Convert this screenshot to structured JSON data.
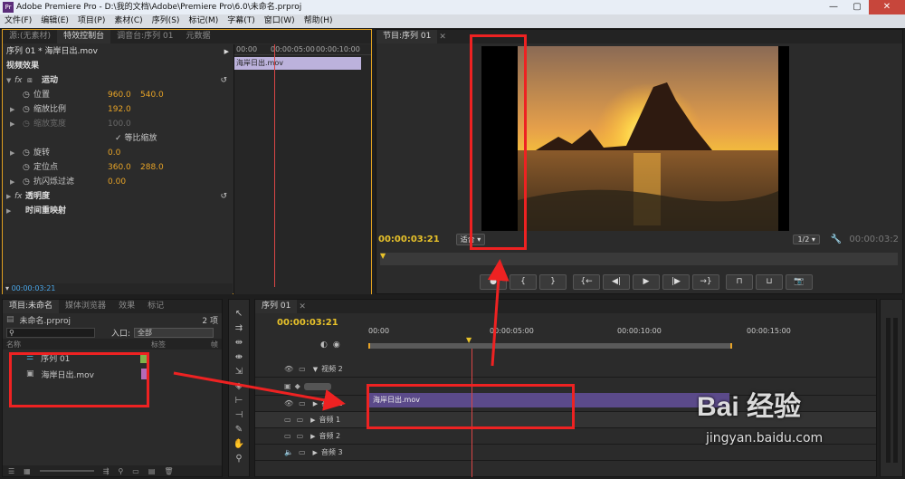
{
  "window": {
    "title": "Adobe Premiere Pro - D:\\我的文档\\Adobe\\Premiere Pro\\6.0\\未命名.prproj",
    "app_icon": "Pr",
    "buttons": [
      "—",
      "▢",
      "✕"
    ]
  },
  "menu": [
    "文件(F)",
    "编辑(E)",
    "项目(P)",
    "素材(C)",
    "序列(S)",
    "标记(M)",
    "字幕(T)",
    "窗口(W)",
    "帮助(H)"
  ],
  "source_panel": {
    "tabs": [
      "源:(无素材)",
      "特效控制台",
      "调音台:序列 01",
      "元数据"
    ],
    "header": "序列 01 * 海岸日出.mov",
    "section": "视频效果",
    "motion": "运动",
    "properties": [
      {
        "label": "位置",
        "v1": "960.0",
        "v2": "540.0"
      },
      {
        "label": "缩放比例",
        "v1": "192.0",
        "v2": ""
      },
      {
        "label": "缩放宽度",
        "v1": "100.0",
        "v2": ""
      },
      {
        "label": "等比缩放",
        "v1": "",
        "v2": ""
      },
      {
        "label": "旋转",
        "v1": "0.0",
        "v2": ""
      },
      {
        "label": "定位点",
        "v1": "360.0",
        "v2": "288.0"
      },
      {
        "label": "抗闪烁过滤",
        "v1": "0.00",
        "v2": ""
      }
    ],
    "opacity": "透明度",
    "time_remap": "时间重映射",
    "ruler": [
      "00:00",
      "00:00:05:00",
      "00:00:10:00"
    ],
    "clip": "海岸日出.mov",
    "timecode": "00:00:03:21"
  },
  "program": {
    "tab": "节目:序列 01",
    "timecode": "00:00:03:21",
    "fit": "适合",
    "quality": "1/2",
    "end_timecode": "00:00:03:2"
  },
  "transport": [
    "●",
    "{",
    "}",
    "{←",
    "◀|",
    "▶",
    "|▶",
    "→}",
    "⊓",
    "⊔",
    "📷"
  ],
  "project": {
    "tabs": [
      "项目:未命名",
      "媒体浏览器",
      "效果",
      "标记"
    ],
    "file": "未命名.prproj",
    "count": "2 项",
    "entry_label": "入口:",
    "entry_value": "全部",
    "col_name": "名称",
    "col_label": "标签",
    "col_rate": "帧",
    "items": [
      {
        "name": "序列 01",
        "color": "#7fb24a"
      },
      {
        "name": "海岸日出.mov",
        "color": "#b56ab8"
      }
    ]
  },
  "timeline": {
    "tab": "序列 01",
    "timecode": "00:00:03:21",
    "ruler": [
      "00:00",
      "00:00:05:00",
      "00:00:10:00",
      "00:00:15:00"
    ],
    "tracks": [
      {
        "name": "视频 2"
      },
      {
        "name": "视频 1"
      },
      {
        "name": "音频 1"
      },
      {
        "name": "音频 2"
      },
      {
        "name": "音频 3"
      }
    ],
    "clip": "海岸日出.mov"
  },
  "watermark": {
    "brand": "Bai 经验",
    "url": "jingyan.baidu.com"
  },
  "colors": {
    "accent": "#e8a427",
    "playhead": "#d94646",
    "clip": "#5b4a8a",
    "annotation": "#ee2222"
  }
}
